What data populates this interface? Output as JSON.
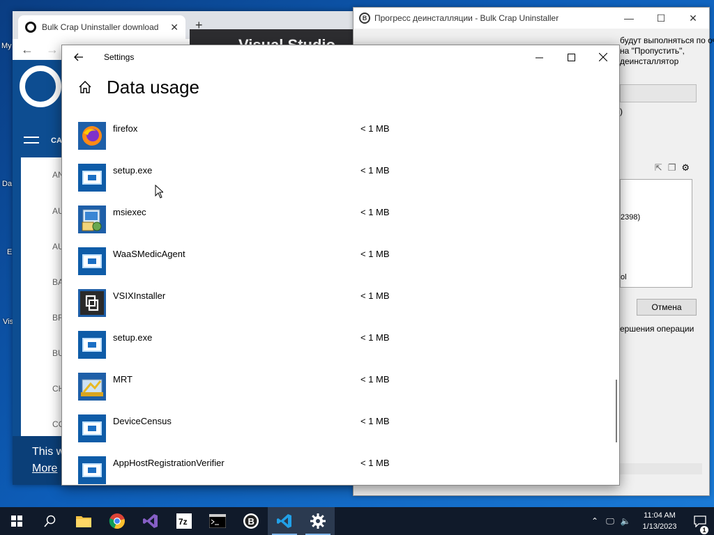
{
  "desktop": {
    "icons": [
      "My",
      "Da",
      "E",
      "Vis"
    ]
  },
  "browser": {
    "tab_title": "Bulk Crap Uninstaller download",
    "new_tab_icon": "plus-icon",
    "site_nav_label": "CA",
    "categories": [
      "AN",
      "AU",
      "AU",
      "BA",
      "BR",
      "BU",
      "CH",
      "CO"
    ],
    "banner_text": "This w",
    "banner_link": "More"
  },
  "vs_window": {
    "title": "Visual Studio"
  },
  "bcu": {
    "title": "Прогресс деинсталляции - Bulk Crap Uninstaller",
    "info_lines": [
      "будут выполняться по очереди.",
      "на \"Пропустить\",",
      "деинсталлятор"
    ],
    "status_suffix": ")",
    "list_items": [
      "2398)",
      "ol"
    ],
    "cancel_label": "Отмена",
    "completion_text": "ершения операции"
  },
  "settings": {
    "app_title": "Settings",
    "page_title": "Data usage",
    "apps": [
      {
        "name": "firefox",
        "usage": "< 1 MB",
        "icon": "firefox-icon"
      },
      {
        "name": "setup.exe",
        "usage": "< 1 MB",
        "icon": "exe-icon"
      },
      {
        "name": "msiexec",
        "usage": "< 1 MB",
        "icon": "msiexec-icon"
      },
      {
        "name": "WaaSMedicAgent",
        "usage": "< 1 MB",
        "icon": "exe-icon"
      },
      {
        "name": "VSIXInstaller",
        "usage": "< 1 MB",
        "icon": "vsix-icon"
      },
      {
        "name": "setup.exe",
        "usage": "< 1 MB",
        "icon": "exe-icon"
      },
      {
        "name": "MRT",
        "usage": "< 1 MB",
        "icon": "mrt-icon"
      },
      {
        "name": "DeviceCensus",
        "usage": "< 1 MB",
        "icon": "exe-icon"
      },
      {
        "name": "AppHostRegistrationVerifier",
        "usage": "< 1 MB",
        "icon": "exe-icon"
      }
    ]
  },
  "taskbar": {
    "apps": [
      "start-icon",
      "search-icon",
      "file-explorer-icon",
      "chrome-icon",
      "visual-studio-icon",
      "7zip-icon",
      "terminal-icon",
      "bcu-icon",
      "vs-code-icon",
      "settings-icon"
    ],
    "active_app": "settings-icon",
    "time": "11:04 AM",
    "date": "1/13/2023",
    "notification_count": "1"
  }
}
